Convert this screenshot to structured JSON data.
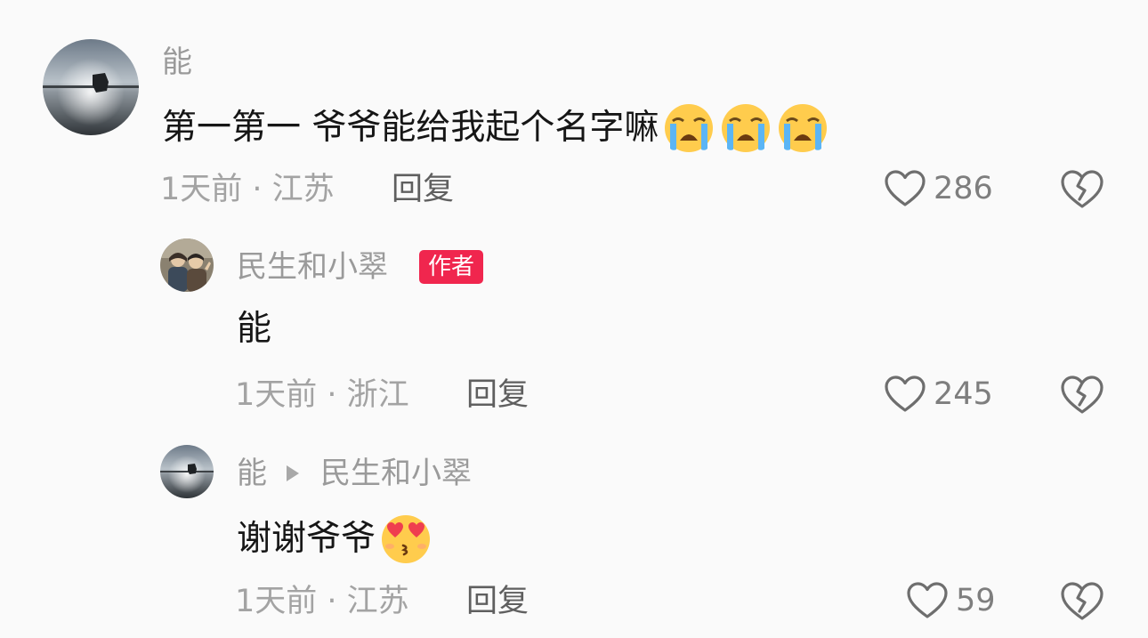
{
  "comments": [
    {
      "username": "能",
      "text": "第一第一 爷爷能给我起个名字嘛",
      "emojis": [
        "crying-face",
        "crying-face",
        "crying-face"
      ],
      "time": "1天前",
      "location": "· 江苏",
      "reply_label": "回复",
      "likes": "286"
    },
    {
      "username": "民生和小翠",
      "badge": "作者",
      "text": "能",
      "time": "1天前",
      "location": "· 浙江",
      "reply_label": "回复",
      "likes": "245"
    },
    {
      "username": "能",
      "reply_to": "民生和小翠",
      "text": "谢谢爷爷",
      "emojis": [
        "heart-eyes-kiss-face"
      ],
      "time": "1天前",
      "location": "· 江苏",
      "reply_label": "回复",
      "likes": "59"
    }
  ],
  "colors": {
    "background": "#fafafa",
    "badge": "#f0264e",
    "meta_text": "#a3a3a3",
    "body_text": "#161616"
  },
  "icons": {
    "like": "heart-outline-icon",
    "dislike": "broken-heart-icon"
  }
}
